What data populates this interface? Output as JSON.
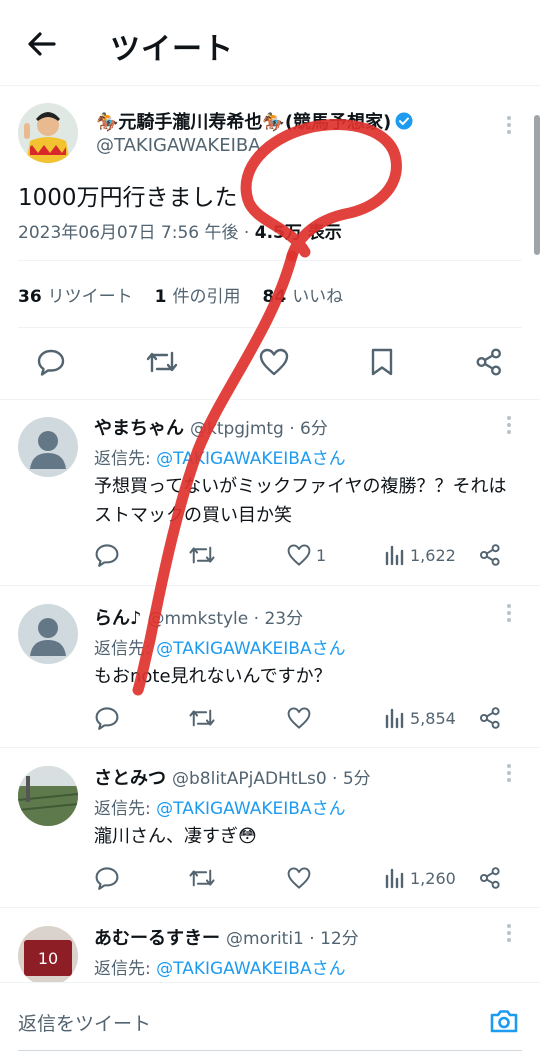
{
  "header": {
    "title": "ツイート",
    "back_icon": "back-arrow-icon"
  },
  "tweet": {
    "author_name": "🏇元騎手瀧川寿希也🏇(競馬予想家)",
    "handle": "@TAKIGAWAKEIBA",
    "text": "1000万円行きました",
    "date": "2023年06月07日 7:56 午後",
    "views": "4.5万 表示",
    "retweets_count": "36",
    "retweets_label": "リツイート",
    "quotes_count": "1",
    "quotes_label": "件の引用",
    "likes_count": "84",
    "likes_label": "いいね"
  },
  "replies": [
    {
      "name": "やまちゃん",
      "handle": "@ktpgjmtg · 6分",
      "reply_label": "返信先:",
      "reply_to": "@TAKIGAWAKEIBAさん",
      "text": "予想買ってないがミックファイヤの複勝？？それはストマックの買い目か笑",
      "likes": "1",
      "views": "1,622"
    },
    {
      "name": "らん♪",
      "handle": "@mmkstyle · 23分",
      "reply_label": "返信先:",
      "reply_to": "@TAKIGAWAKEIBAさん",
      "text": "もおnote見れないんですか？",
      "likes": "",
      "views": "5,854"
    },
    {
      "name": "さとみつ",
      "handle": "@b8litAPjADHtLs0 · 5分",
      "reply_label": "返信先:",
      "reply_to": "@TAKIGAWAKEIBAさん",
      "text": "瀧川さん、凄すぎ😳",
      "likes": "",
      "views": "1,260"
    },
    {
      "name": "あむーるすきー",
      "handle": "@moriti1 · 12分",
      "reply_label": "返信先:",
      "reply_to": "@TAKIGAWAKEIBAさん",
      "text": "",
      "avatar_text": "10"
    }
  ],
  "compose": {
    "placeholder": "返信をツイート"
  },
  "colors": {
    "accent": "#1d9bf0",
    "text": "#0f1419",
    "muted": "#536471",
    "annotation": "#e0322d"
  }
}
